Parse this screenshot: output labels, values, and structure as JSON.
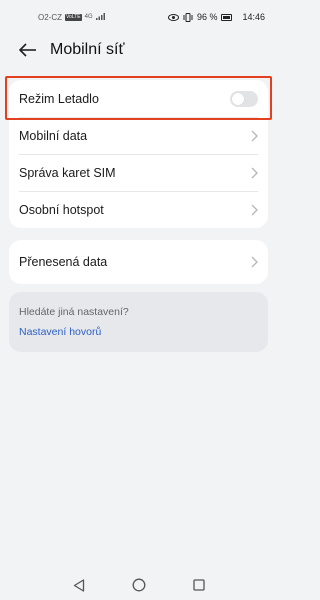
{
  "status_bar": {
    "carrier": "O2-CZ",
    "sim_badge": "VoLTE",
    "network": "4G",
    "battery": "96 %",
    "time": "14:46"
  },
  "header": {
    "title": "Mobilní síť"
  },
  "group1": {
    "items": [
      {
        "label": "Režim Letadlo",
        "type": "toggle",
        "checked": false
      },
      {
        "label": "Mobilní data",
        "type": "link"
      },
      {
        "label": "Správa karet SIM",
        "type": "link"
      },
      {
        "label": "Osobní hotspot",
        "type": "link"
      }
    ]
  },
  "group2": {
    "items": [
      {
        "label": "Přenesená data",
        "type": "link"
      }
    ]
  },
  "suggestions": {
    "prompt": "Hledáte jiná nastavení?",
    "link": "Nastavení hovorů"
  },
  "colors": {
    "accent_link": "#2d5fc4",
    "highlight": "#e2401e",
    "background": "#f1f3f5"
  }
}
